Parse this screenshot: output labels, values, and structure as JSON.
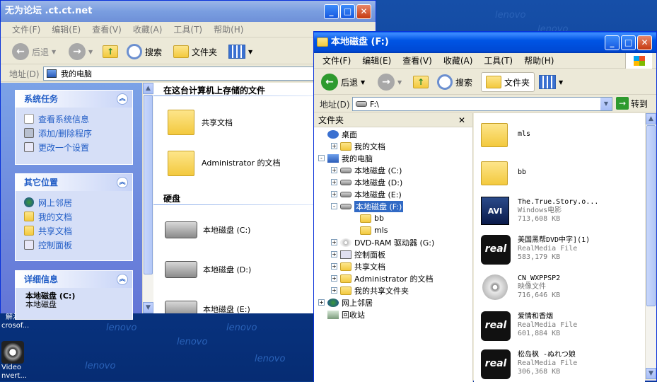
{
  "desktop": {
    "watermark_text": "lenovo",
    "icon_top_label1": "解注",
    "icon_top_label2": "crosof...",
    "icon_label1": "Video",
    "icon_label2": "nvert..."
  },
  "win1": {
    "title": "无为论坛 .ct.ct.net",
    "menus": [
      "文件(F)",
      "编辑(E)",
      "查看(V)",
      "收藏(A)",
      "工具(T)",
      "帮助(H)"
    ],
    "back": "后退",
    "search": "搜索",
    "folders": "文件夹",
    "address_label": "地址(D)",
    "address_value": "我的电脑",
    "system_tasks": {
      "title": "系统任务",
      "items": [
        "查看系统信息",
        "添加/删除程序",
        "更改一个设置"
      ]
    },
    "other_places": {
      "title": "其它位置",
      "items": [
        "网上邻居",
        "我的文档",
        "共享文档",
        "控制面板"
      ]
    },
    "details": {
      "title": "详细信息",
      "name": "本地磁盘 (C:)",
      "type": "本地磁盘"
    },
    "section_files": "在这台计算机上存储的文件",
    "file_items": [
      "共享文档",
      "Administrator 的文档"
    ],
    "section_drives": "硬盘",
    "drive_items": [
      "本地磁盘 (C:)",
      "本地磁盘 (D:)",
      "本地磁盘 (E:)"
    ]
  },
  "win2": {
    "title": "本地磁盘  (F:)",
    "menus": [
      "文件(F)",
      "编辑(E)",
      "查看(V)",
      "收藏(A)",
      "工具(T)",
      "帮助(H)"
    ],
    "back": "后退",
    "search": "搜索",
    "folders": "文件夹",
    "address_label": "地址(D)",
    "address_value": "F:\\",
    "go": "转到",
    "tree_header": "文件夹",
    "tree": [
      {
        "label": "桌面",
        "exp": ""
      },
      {
        "label": "我的文档",
        "exp": "+"
      },
      {
        "label": "我的电脑",
        "exp": "-"
      },
      {
        "label": "本地磁盘 (C:)",
        "exp": "+"
      },
      {
        "label": "本地磁盘 (D:)",
        "exp": "+"
      },
      {
        "label": "本地磁盘 (E:)",
        "exp": "+"
      },
      {
        "label": "本地磁盘 (F:)",
        "exp": "-"
      },
      {
        "label": "bb",
        "exp": ""
      },
      {
        "label": "mls",
        "exp": ""
      },
      {
        "label": "DVD-RAM 驱动器 (G:)",
        "exp": "+"
      },
      {
        "label": "控制面板",
        "exp": "+"
      },
      {
        "label": "共享文档",
        "exp": "+"
      },
      {
        "label": "Administrator 的文档",
        "exp": "+"
      },
      {
        "label": "我的共享文件夹",
        "exp": "+"
      },
      {
        "label": "网上邻居",
        "exp": "+"
      },
      {
        "label": "回收站",
        "exp": ""
      }
    ],
    "files": [
      {
        "name": "mls",
        "type": "",
        "size": "",
        "icon": "folder"
      },
      {
        "name": "bb",
        "type": "",
        "size": "",
        "icon": "folder"
      },
      {
        "name": "The.True.Story.o...",
        "type": "Windows电影",
        "size": "713,608 KB",
        "icon": "avi"
      },
      {
        "name": "美国黑帮DVD中字](1)",
        "type": "RealMedia File",
        "size": "583,179 KB",
        "icon": "real"
      },
      {
        "name": "CN_WXPPSP2",
        "type": "映像文件",
        "size": "716,646 KB",
        "icon": "disc"
      },
      {
        "name": "爱情和香烟",
        "type": "RealMedia File",
        "size": "601,884 KB",
        "icon": "real"
      },
      {
        "name": "松岛枫 -ぬれつ娘",
        "type": "RealMedia File",
        "size": "306,368 KB",
        "icon": "real"
      }
    ]
  }
}
